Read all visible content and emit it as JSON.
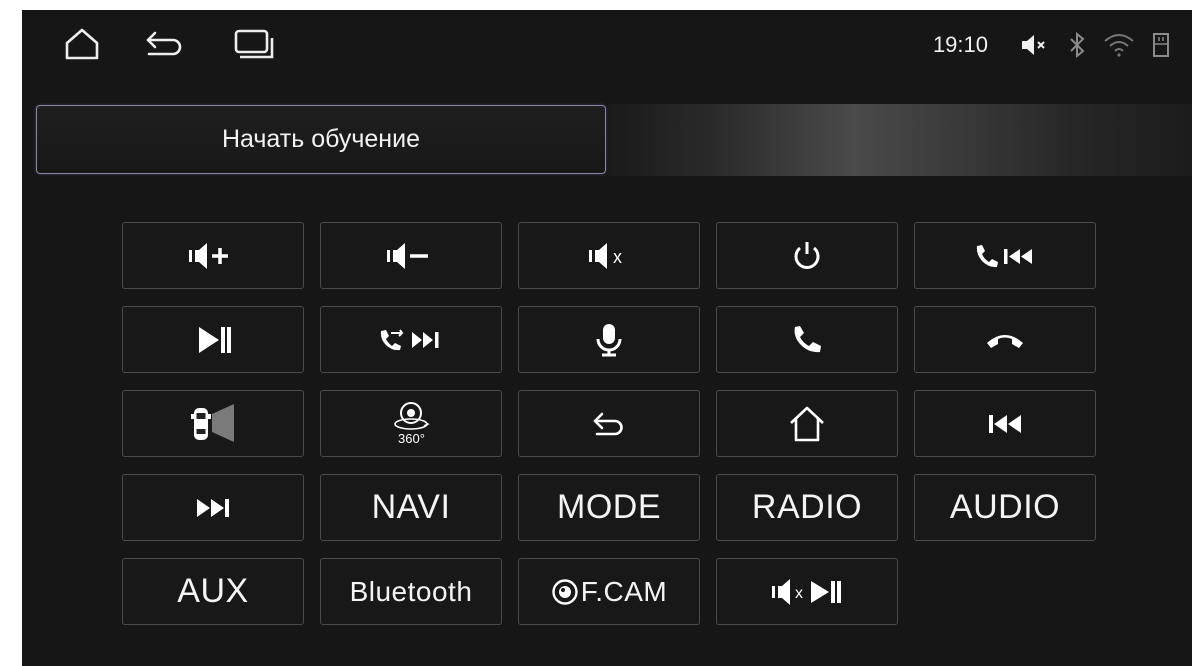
{
  "status": {
    "clock": "19:10",
    "icons": [
      "volume-muted-icon",
      "bluetooth-icon",
      "wifi-icon",
      "sd-card-icon"
    ]
  },
  "nav": [
    "home-icon",
    "back-icon",
    "recent-apps-icon"
  ],
  "learn_button": {
    "label": "Начать обучение"
  },
  "keys": {
    "navi": "NAVI",
    "mode": "MODE",
    "radio": "RADIO",
    "audio": "AUDIO",
    "aux": "AUX",
    "bluetooth": "Bluetooth",
    "fcam": "F.CAM",
    "mute_x": "x"
  },
  "colors": {
    "background": "#161616",
    "key_border": "#4b4b4b",
    "learn_border": "#8a86a8"
  }
}
